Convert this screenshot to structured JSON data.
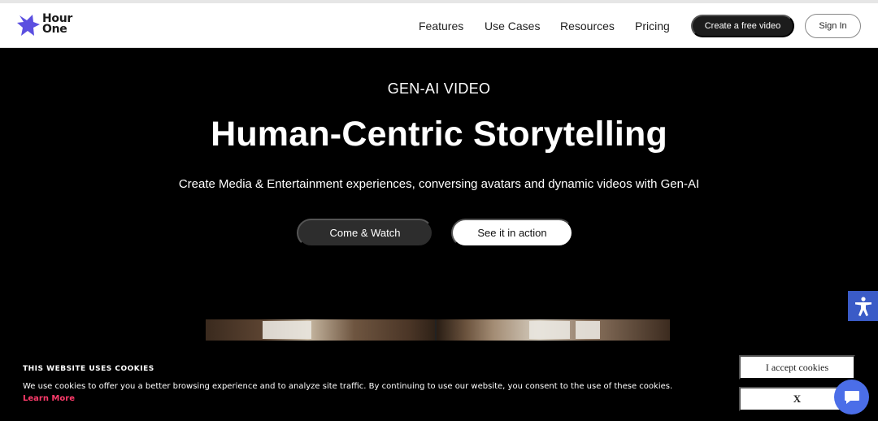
{
  "nav": {
    "logo_line1": "Hour",
    "logo_line2": "One",
    "features": "Features",
    "use_cases": "Use Cases",
    "resources": "Resources",
    "pricing": "Pricing",
    "create_button": "Create a free video",
    "signin_button": "Sign In"
  },
  "hero": {
    "eyebrow": "GEN-AI VIDEO",
    "headline": "Human-Centric Storytelling",
    "subtitle": "Create Media & Entertainment experiences, conversing avatars and dynamic videos with Gen-AI",
    "watch_button": "Come & Watch",
    "action_button": "See it in action"
  },
  "cookie": {
    "title": "THIS WEBSITE USES COOKIES",
    "text": "We use cookies to offer you a better browsing experience and to analyze site traffic. By continuing to use our website, you consent to the use of these cookies.",
    "link": "Learn More",
    "accept_button": "I accept cookies",
    "close_button": "X"
  },
  "icons": {
    "logo": "hour-one-logo-icon",
    "accessibility": "accessibility-icon",
    "chat": "chat-bubble-icon"
  },
  "colors": {
    "brand": "#5b4fe0",
    "background": "#000000",
    "link_accent": "#ff3b6b",
    "accessibility": "#3a5bc7",
    "chat": "#4b6ee8"
  }
}
